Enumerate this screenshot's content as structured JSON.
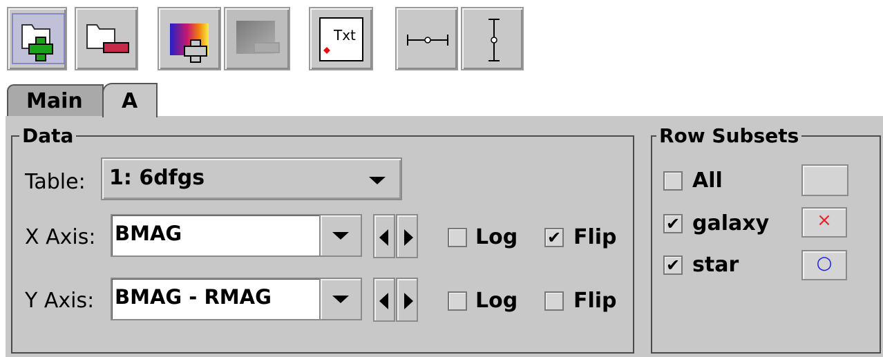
{
  "toolbar": {
    "buttons": [
      {
        "name": "add-plot-icon",
        "state": "pressed"
      },
      {
        "name": "remove-plot-icon",
        "state": "normal"
      },
      {
        "name": "add-color-icon",
        "state": "normal"
      },
      {
        "name": "remove-color-icon",
        "state": "disabled"
      },
      {
        "name": "text-label-icon",
        "state": "normal",
        "text": "Txt"
      },
      {
        "name": "x-errorbar-icon",
        "state": "normal"
      },
      {
        "name": "y-errorbar-icon",
        "state": "normal"
      }
    ]
  },
  "tabs": [
    {
      "label": "Main",
      "selected": false
    },
    {
      "label": "A",
      "selected": true
    }
  ],
  "data_group": {
    "legend": "Data",
    "table_label": "Table:",
    "table_value": "1: 6dfgs",
    "x_axis": {
      "label": "X Axis:",
      "value": "BMAG",
      "log_label": "Log",
      "log": false,
      "flip_label": "Flip",
      "flip": true
    },
    "y_axis": {
      "label": "Y Axis:",
      "value": "BMAG - RMAG",
      "log_label": "Log",
      "log": false,
      "flip_label": "Flip",
      "flip": false
    }
  },
  "subsets_group": {
    "legend": "Row Subsets",
    "items": [
      {
        "label": "All",
        "checked": false,
        "marker": ""
      },
      {
        "label": "galaxy",
        "checked": true,
        "marker": "×",
        "color": "#e8202a"
      },
      {
        "label": "star",
        "checked": true,
        "marker": "○",
        "color": "#1a1af0"
      }
    ]
  },
  "colors": {
    "panel": "#c8c8c8",
    "tab_selected": "#c8c8c8",
    "tab_unselected": "#a9a9a9"
  }
}
